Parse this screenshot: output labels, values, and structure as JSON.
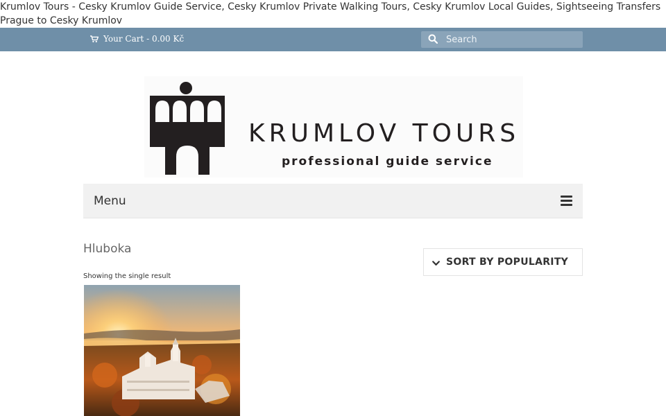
{
  "site": {
    "title": "Krumlov Tours - Cesky Krumlov Guide Service, Cesky Krumlov Private Walking Tours, Cesky Krumlov Local Guides, Sightseeing Transfers Prague to Cesky Krumlov"
  },
  "topbar": {
    "cart_label": "Your Cart - 0.00 Kč",
    "cart_icon": "cart-icon",
    "search_icon": "search-icon",
    "search_placeholder": "Search",
    "search_value": "",
    "background_color": "#6f8fa8"
  },
  "logo": {
    "name": "KRUMLOV TOURS",
    "tagline": "professional guide service"
  },
  "nav": {
    "menu_label": "Menu",
    "menu_icon": "hamburger-icon"
  },
  "content": {
    "page_title": "Hluboka",
    "result_count": "Showing the single result",
    "sort_label": "SORT BY POPULARITY",
    "sort_icon": "chevron-down-icon"
  }
}
